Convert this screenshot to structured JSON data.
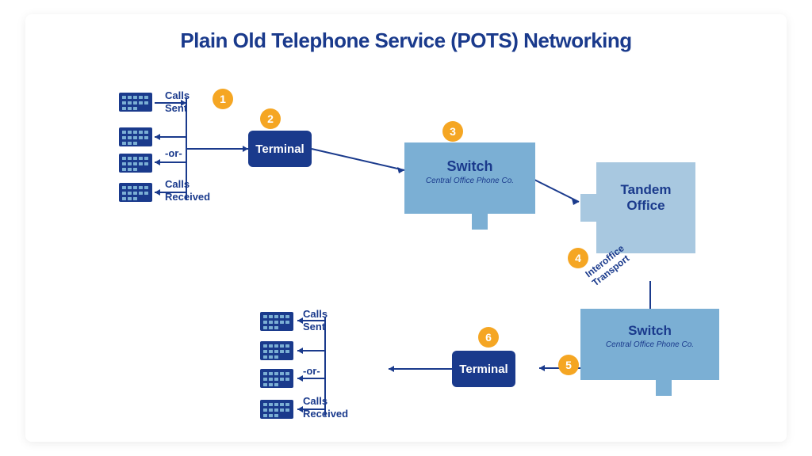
{
  "title": "Plain Old Telephone Service (POTS) Networking",
  "badges": [
    {
      "id": 1,
      "label": "1"
    },
    {
      "id": 2,
      "label": "2"
    },
    {
      "id": 3,
      "label": "3"
    },
    {
      "id": 4,
      "label": "4"
    },
    {
      "id": 5,
      "label": "5"
    },
    {
      "id": 6,
      "label": "6"
    }
  ],
  "terminal1": {
    "label": "Terminal"
  },
  "terminal2": {
    "label": "Terminal"
  },
  "switch1": {
    "label": "Switch",
    "sublabel": "Central Office Phone Co."
  },
  "switch2": {
    "label": "Switch",
    "sublabel": "Central Office Phone Co."
  },
  "tandem": {
    "label": "Tandem\nOffice"
  },
  "top_group": {
    "calls_sent": "Calls\nSent",
    "or": "-or-",
    "calls_received": "Calls\nReceived"
  },
  "bottom_group": {
    "calls_sent": "Calls\nSent",
    "or": "-or-",
    "calls_received": "Calls\nReceived"
  },
  "interoffice": "Interoffice\nTransport"
}
